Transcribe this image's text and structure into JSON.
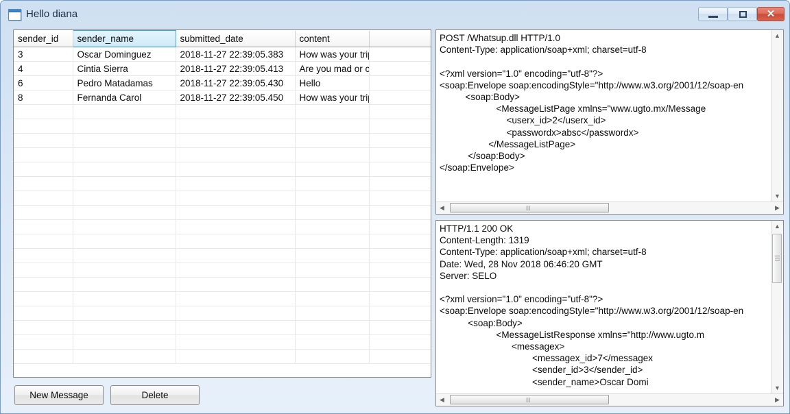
{
  "window": {
    "title": "Hello diana",
    "icon": "window-icon",
    "controls": {
      "minimize": "minimize-icon",
      "maximize": "maximize-icon",
      "close": "✕"
    }
  },
  "grid": {
    "columns": [
      "sender_id",
      "sender_name",
      "submitted_date",
      "content",
      ""
    ],
    "selected_column": "sender_name",
    "rows": [
      [
        "3",
        "Oscar Dominguez",
        "2018-11-27 22:39:05.383",
        "How was your trip to ...",
        ""
      ],
      [
        "4",
        "Cintia Sierra",
        "2018-11-27 22:39:05.413",
        "Are you mad or crazy?",
        ""
      ],
      [
        "6",
        "Pedro Matadamas",
        "2018-11-27 22:39:05.430",
        "Hello",
        ""
      ],
      [
        "8",
        "Fernanda Carol",
        "2018-11-27 22:39:05.450",
        "How was your trip to ...",
        ""
      ]
    ],
    "empty_row_count": 18
  },
  "request": {
    "text": "POST /Whatsup.dll HTTP/1.0\nContent-Type: application/soap+xml; charset=utf-8\n\n<?xml version=\"1.0\" encoding=\"utf-8\"?>\n<soap:Envelope soap:encodingStyle=\"http://www.w3.org/2001/12/soap-en\n          <soap:Body>\n                      <MessageListPage xmlns=\"www.ugto.mx/Message\n                          <userx_id>2</userx_id>\n                          <passwordx>absc</passwordx>\n                   </MessageListPage>\n           </soap:Body>\n</soap:Envelope>"
  },
  "response": {
    "text": "HTTP/1.1 200 OK\nContent-Length: 1319\nContent-Type: application/soap+xml; charset=utf-8\nDate: Wed, 28 Nov 2018 06:46:20 GMT\nServer: SELO\n\n<?xml version=\"1.0\" encoding=\"utf-8\"?>\n<soap:Envelope soap:encodingStyle=\"http://www.w3.org/2001/12/soap-en\n           <soap:Body>\n                      <MessageListResponse xmlns=\"http://www.ugto.m\n                            <messagex>\n                                    <messagex_id>7</messagex\n                                    <sender_id>3</sender_id>\n                                    <sender_name>Oscar Domi"
  },
  "buttons": {
    "new_message": "New Message",
    "delete": "Delete"
  },
  "scrollbars": {
    "up_arrow": "▲",
    "down_arrow": "▼",
    "left_arrow": "◀",
    "right_arrow": "▶"
  },
  "colors": {
    "frame": "#6f9dd0",
    "title_gradient_top": "#cfe0f2",
    "selected_header": "#cdeaf8",
    "close_button": "#c94b36"
  }
}
